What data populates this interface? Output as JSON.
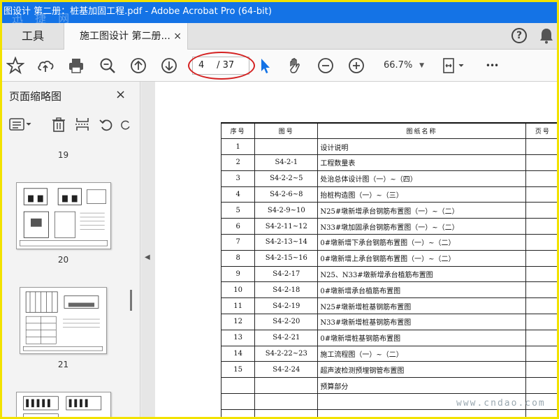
{
  "window": {
    "title": "图设计 第二册：桩基加固工程.pdf - Adobe Acrobat Pro (64-bit)",
    "watermark_top": "迅 捷 网"
  },
  "tabs": {
    "tools_label": "工具",
    "doc_label": "施工图设计 第二册...",
    "close_glyph": "×",
    "help_glyph": "?"
  },
  "toolbar": {
    "page_current": "4",
    "page_total": "/ 37",
    "zoom": "66.7%",
    "zoom_caret": "▼",
    "more_glyph": "•••"
  },
  "sidebar": {
    "title": "页面缩略图",
    "close_glyph": "×",
    "thumbnails": [
      {
        "label": "19"
      },
      {
        "label": "20"
      },
      {
        "label": "21"
      }
    ]
  },
  "document": {
    "headers": [
      "序号",
      "图号",
      "图纸名称",
      "页号"
    ],
    "rows": [
      {
        "seq": "1",
        "code": "",
        "name": "设计说明"
      },
      {
        "seq": "2",
        "code": "S4-2-1",
        "name": "工程数量表"
      },
      {
        "seq": "3",
        "code": "S4-2-2~5",
        "name": "处治总体设计图（一）~（四）"
      },
      {
        "seq": "4",
        "code": "S4-2-6~8",
        "name": "抬桩构造图（一）~（三）"
      },
      {
        "seq": "5",
        "code": "S4-2-9~10",
        "name": "N25#墩新增承台钢筋布置图（一）~（二）"
      },
      {
        "seq": "6",
        "code": "S4-2-11~12",
        "name": "N33#墩加固承台钢筋布置图（一）~（二）"
      },
      {
        "seq": "7",
        "code": "S4-2-13~14",
        "name": "0#墩新增下承台钢筋布置图（一）~（二）"
      },
      {
        "seq": "8",
        "code": "S4-2-15~16",
        "name": "0#墩新增上承台钢筋布置图（一）~（二）"
      },
      {
        "seq": "9",
        "code": "S4-2-17",
        "name": "N25、N33#墩新增承台植筋布置图"
      },
      {
        "seq": "10",
        "code": "S4-2-18",
        "name": "0#墩新增承台植筋布置图"
      },
      {
        "seq": "11",
        "code": "S4-2-19",
        "name": "N25#墩新增桩基钢筋布置图"
      },
      {
        "seq": "12",
        "code": "S4-2-20",
        "name": "N33#墩新增桩基钢筋布置图"
      },
      {
        "seq": "13",
        "code": "S4-2-21",
        "name": "0#墩新增桩基钢筋布置图"
      },
      {
        "seq": "14",
        "code": "S4-2-22~23",
        "name": "施工流程图（一）~（二）"
      },
      {
        "seq": "15",
        "code": "S4-2-24",
        "name": "超声波检测预埋钢管布置图"
      },
      {
        "seq": "",
        "code": "",
        "name": "预算部分"
      },
      {
        "seq": "",
        "code": "",
        "name": ""
      },
      {
        "seq": "",
        "code": "",
        "name": ""
      }
    ]
  },
  "watermark_bottom": "www.cndao.com",
  "colors": {
    "accent": "#1473e6",
    "frame": "#f2e200",
    "highlight": "#d42020"
  }
}
